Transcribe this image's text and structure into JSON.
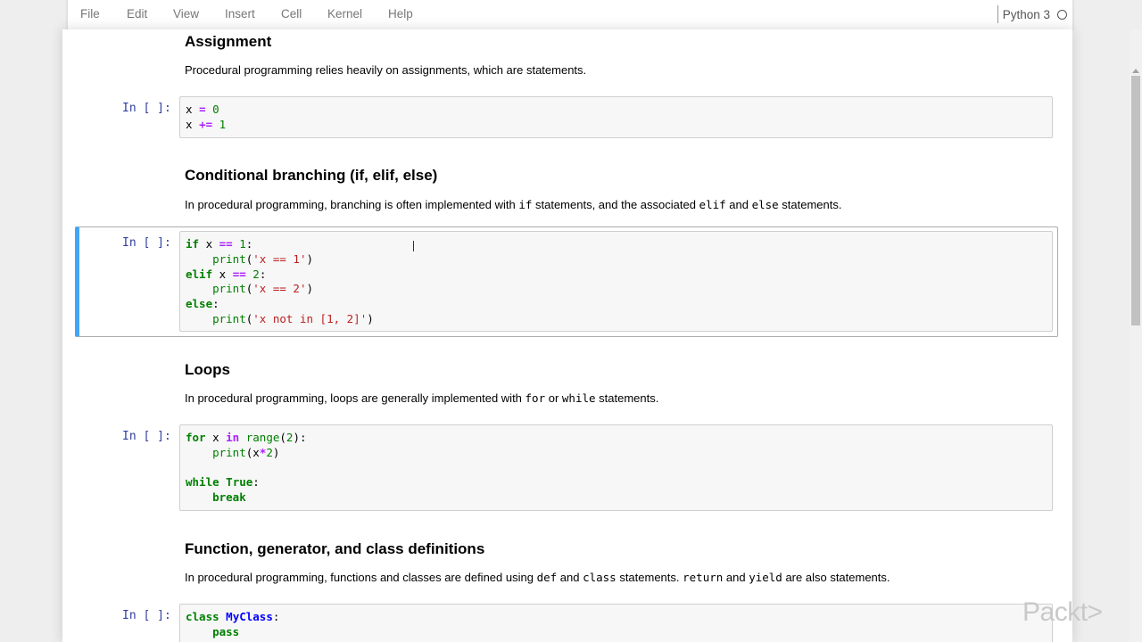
{
  "menubar": {
    "items": [
      "File",
      "Edit",
      "View",
      "Insert",
      "Cell",
      "Kernel",
      "Help"
    ],
    "kernel_name": "Python 3"
  },
  "cells": [
    {
      "type": "markdown",
      "heading": "Assignment",
      "text": "Procedural programming relies heavily on assignments, which are statements."
    },
    {
      "type": "code",
      "prompt": "In [ ]:",
      "lines": [
        "x = 0",
        "x += 1"
      ]
    },
    {
      "type": "markdown",
      "heading": "Conditional branching (if, elif, else)",
      "text_parts": [
        "In procedural programming, branching is often implemented with ",
        "if",
        " statements, and the associated ",
        "elif",
        " and ",
        "else",
        " statements."
      ]
    },
    {
      "type": "code",
      "prompt": "In [ ]:",
      "selected": true,
      "lines": [
        "if x == 1:",
        "    print('x == 1')",
        "elif x == 2:",
        "    print('x == 2')",
        "else:",
        "    print('x not in [1, 2]')"
      ]
    },
    {
      "type": "markdown",
      "heading": "Loops",
      "text_parts": [
        "In procedural programming, loops are generally implemented with ",
        "for",
        " or ",
        "while",
        " statements."
      ]
    },
    {
      "type": "code",
      "prompt": "In [ ]:",
      "lines": [
        "for x in range(2):",
        "    print(x*2)",
        "",
        "while True:",
        "    break"
      ]
    },
    {
      "type": "markdown",
      "heading": "Function, generator, and class definitions",
      "text_parts": [
        "In procedural programming, functions and classes are defined using ",
        "def",
        " and ",
        "class",
        " statements. ",
        "return",
        " and ",
        "yield",
        " are also statements."
      ]
    },
    {
      "type": "code",
      "prompt": "In [ ]:",
      "lines": [
        "class MyClass:",
        "    pass"
      ]
    }
  ],
  "watermark": "Packt>"
}
